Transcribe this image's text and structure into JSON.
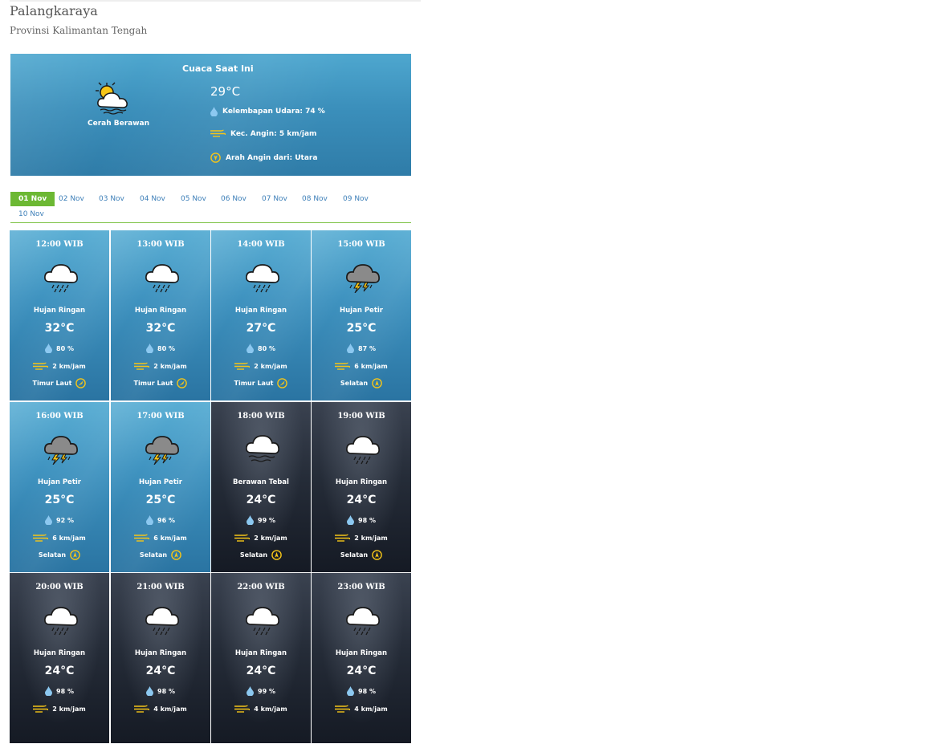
{
  "location": {
    "city": "Palangkaraya",
    "province": "Provinsi Kalimantan Tengah"
  },
  "current": {
    "title": "Cuaca Saat Ini",
    "icon": "partly-cloudy-icon",
    "description": "Cerah Berawan",
    "temperature": "29°C",
    "humidity": "Kelembapan Udara: 74 %",
    "wind_speed": "Kec. Angin: 5 km/jam",
    "wind_direction": "Arah Angin dari: Utara"
  },
  "tabs": [
    {
      "label": "01 Nov",
      "active": true
    },
    {
      "label": "02 Nov"
    },
    {
      "label": "03 Nov"
    },
    {
      "label": "04 Nov"
    },
    {
      "label": "05 Nov"
    },
    {
      "label": "06 Nov"
    },
    {
      "label": "07 Nov"
    },
    {
      "label": "08 Nov"
    },
    {
      "label": "09 Nov"
    },
    {
      "label": "10 Nov"
    }
  ],
  "forecast": [
    {
      "time": "12:00 WIB",
      "icon": "light-rain-icon",
      "desc": "Hujan Ringan",
      "temp": "32°C",
      "humidity": "80 %",
      "wind": "2 km/jam",
      "dir": "Timur Laut",
      "theme": "day"
    },
    {
      "time": "13:00 WIB",
      "icon": "light-rain-icon",
      "desc": "Hujan Ringan",
      "temp": "32°C",
      "humidity": "80 %",
      "wind": "2 km/jam",
      "dir": "Timur Laut",
      "theme": "day"
    },
    {
      "time": "14:00 WIB",
      "icon": "light-rain-icon",
      "desc": "Hujan Ringan",
      "temp": "27°C",
      "humidity": "80 %",
      "wind": "2 km/jam",
      "dir": "Timur Laut",
      "theme": "day"
    },
    {
      "time": "15:00 WIB",
      "icon": "thunderstorm-icon",
      "desc": "Hujan Petir",
      "temp": "25°C",
      "humidity": "87 %",
      "wind": "6 km/jam",
      "dir": "Selatan",
      "theme": "day"
    },
    {
      "time": "16:00 WIB",
      "icon": "thunderstorm-icon",
      "desc": "Hujan Petir",
      "temp": "25°C",
      "humidity": "92 %",
      "wind": "6 km/jam",
      "dir": "Selatan",
      "theme": "day"
    },
    {
      "time": "17:00 WIB",
      "icon": "thunderstorm-icon",
      "desc": "Hujan Petir",
      "temp": "25°C",
      "humidity": "96 %",
      "wind": "6 km/jam",
      "dir": "Selatan",
      "theme": "day"
    },
    {
      "time": "18:00 WIB",
      "icon": "overcast-icon",
      "desc": "Berawan Tebal",
      "temp": "24°C",
      "humidity": "99 %",
      "wind": "2 km/jam",
      "dir": "Selatan",
      "theme": "night"
    },
    {
      "time": "19:00 WIB",
      "icon": "light-rain-icon",
      "desc": "Hujan Ringan",
      "temp": "24°C",
      "humidity": "98 %",
      "wind": "2 km/jam",
      "dir": "Selatan",
      "theme": "night"
    },
    {
      "time": "20:00 WIB",
      "icon": "light-rain-icon",
      "desc": "Hujan Ringan",
      "temp": "24°C",
      "humidity": "98 %",
      "wind": "2 km/jam",
      "dir": "",
      "theme": "night"
    },
    {
      "time": "21:00 WIB",
      "icon": "light-rain-icon",
      "desc": "Hujan Ringan",
      "temp": "24°C",
      "humidity": "98 %",
      "wind": "4 km/jam",
      "dir": "",
      "theme": "night"
    },
    {
      "time": "22:00 WIB",
      "icon": "light-rain-icon",
      "desc": "Hujan Ringan",
      "temp": "24°C",
      "humidity": "99 %",
      "wind": "4 km/jam",
      "dir": "",
      "theme": "night"
    },
    {
      "time": "23:00 WIB",
      "icon": "light-rain-icon",
      "desc": "Hujan Ringan",
      "temp": "24°C",
      "humidity": "98 %",
      "wind": "4 km/jam",
      "dir": "",
      "theme": "night"
    }
  ],
  "colors": {
    "accent_green": "#6cb833",
    "link_blue": "#3d7fb8",
    "icon_yellow": "#f5c518",
    "drop_blue": "#8cc8f0"
  }
}
